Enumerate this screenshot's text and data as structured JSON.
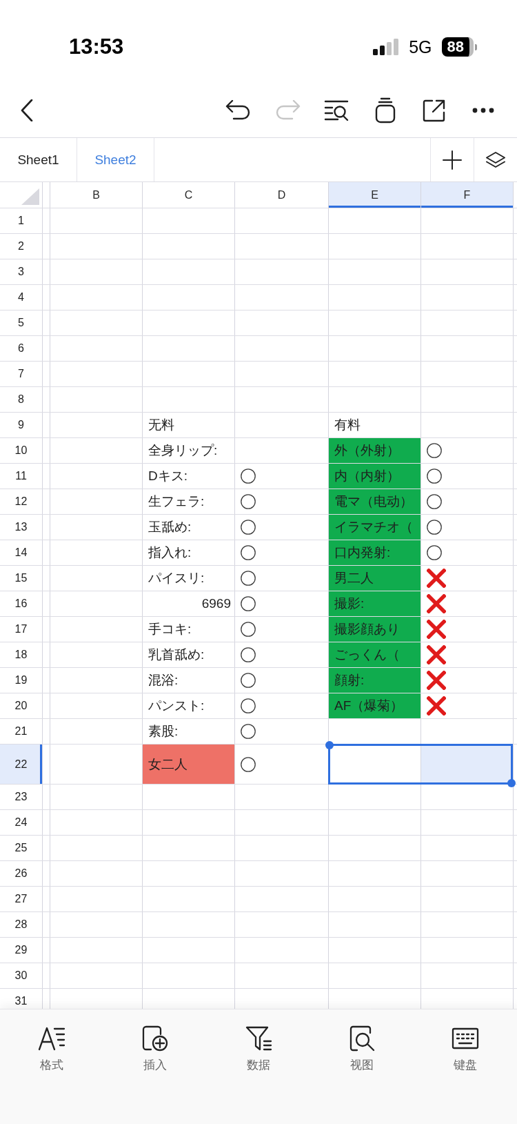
{
  "status_bar": {
    "time": "13:53",
    "network": "5G",
    "battery": "88"
  },
  "toolbar": [
    {
      "kind": "back",
      "disabled": false
    },
    {
      "kind": "undo",
      "disabled": false
    },
    {
      "kind": "redo",
      "disabled": true
    },
    {
      "kind": "find",
      "disabled": false
    },
    {
      "kind": "stack",
      "disabled": false
    },
    {
      "kind": "share",
      "disabled": false
    },
    {
      "kind": "more",
      "disabled": false
    }
  ],
  "sheet_tabs": [
    {
      "label": "Sheet1",
      "selected": false
    },
    {
      "label": "Sheet2",
      "selected": true
    }
  ],
  "sheet_actions": [
    {
      "kind": "add"
    },
    {
      "kind": "layers"
    }
  ],
  "columns": [
    {
      "label": "B",
      "selected": false
    },
    {
      "label": "C",
      "selected": false
    },
    {
      "label": "D",
      "selected": false
    },
    {
      "label": "E",
      "selected": true
    },
    {
      "label": "F",
      "selected": true
    }
  ],
  "rows": [
    {
      "number": "1",
      "selected": false
    },
    {
      "number": "2",
      "selected": false
    },
    {
      "number": "3",
      "selected": false
    },
    {
      "number": "4",
      "selected": false
    },
    {
      "number": "5",
      "selected": false
    },
    {
      "number": "6",
      "selected": false
    },
    {
      "number": "7",
      "selected": false
    },
    {
      "number": "8",
      "selected": false
    },
    {
      "number": "9",
      "selected": false,
      "c": {
        "kind": "text",
        "text": "无料"
      },
      "e": {
        "kind": "text",
        "text": "有料"
      }
    },
    {
      "number": "10",
      "selected": false,
      "c": {
        "kind": "text",
        "text": "全身リップ:"
      },
      "e": {
        "kind": "text",
        "text": "外（外射）",
        "color": "#10ac4e"
      },
      "f": {
        "kind": "circle"
      }
    },
    {
      "number": "11",
      "selected": false,
      "c": {
        "kind": "text",
        "text": "Dキス:"
      },
      "d": {
        "kind": "circle"
      },
      "e": {
        "kind": "text",
        "text": "内（内射）",
        "color": "#10ac4e"
      },
      "f": {
        "kind": "circle"
      }
    },
    {
      "number": "12",
      "selected": false,
      "c": {
        "kind": "text",
        "text": "生フェラ:"
      },
      "d": {
        "kind": "circle"
      },
      "e": {
        "kind": "text",
        "text": "電マ（电动）",
        "color": "#10ac4e"
      },
      "f": {
        "kind": "circle"
      }
    },
    {
      "number": "13",
      "selected": false,
      "c": {
        "kind": "text",
        "text": "玉舐め:"
      },
      "d": {
        "kind": "circle"
      },
      "e": {
        "kind": "text",
        "text": "イラマチオ（",
        "color": "#10ac4e"
      },
      "f": {
        "kind": "circle"
      }
    },
    {
      "number": "14",
      "selected": false,
      "c": {
        "kind": "text",
        "text": "指入れ:"
      },
      "d": {
        "kind": "circle"
      },
      "e": {
        "kind": "text",
        "text": "口内発射:",
        "color": "#10ac4e"
      },
      "f": {
        "kind": "circle"
      }
    },
    {
      "number": "15",
      "selected": false,
      "c": {
        "kind": "text",
        "text": "パイスリ:"
      },
      "d": {
        "kind": "circle"
      },
      "e": {
        "kind": "text",
        "text": "男二人",
        "color": "#10ac4e"
      },
      "f": {
        "kind": "cross"
      }
    },
    {
      "number": "16",
      "selected": false,
      "c": {
        "kind": "number",
        "text": "6969"
      },
      "d": {
        "kind": "circle"
      },
      "e": {
        "kind": "text",
        "text": "撮影:",
        "color": "#10ac4e"
      },
      "f": {
        "kind": "cross"
      }
    },
    {
      "number": "17",
      "selected": false,
      "c": {
        "kind": "text",
        "text": "手コキ:"
      },
      "d": {
        "kind": "circle"
      },
      "e": {
        "kind": "text",
        "text": "撮影顔あり",
        "color": "#10ac4e"
      },
      "f": {
        "kind": "cross"
      }
    },
    {
      "number": "18",
      "selected": false,
      "c": {
        "kind": "text",
        "text": "乳首舐め:"
      },
      "d": {
        "kind": "circle"
      },
      "e": {
        "kind": "text",
        "text": "ごっくん（",
        "color": "#10ac4e"
      },
      "f": {
        "kind": "cross"
      }
    },
    {
      "number": "19",
      "selected": false,
      "c": {
        "kind": "text",
        "text": "混浴:"
      },
      "d": {
        "kind": "circle"
      },
      "e": {
        "kind": "text",
        "text": "顔射:",
        "color": "#10ac4e"
      },
      "f": {
        "kind": "cross"
      }
    },
    {
      "number": "20",
      "selected": false,
      "c": {
        "kind": "text",
        "text": "パンスト:"
      },
      "d": {
        "kind": "circle"
      },
      "e": {
        "kind": "text",
        "text": "AF（爆菊）",
        "color": "#10ac4e"
      },
      "f": {
        "kind": "cross"
      }
    },
    {
      "number": "21",
      "selected": false,
      "c": {
        "kind": "text",
        "text": "素股:"
      },
      "d": {
        "kind": "circle"
      }
    },
    {
      "number": "22",
      "selected": true,
      "c": {
        "kind": "text",
        "text": "女二人",
        "color": "#ee7167"
      },
      "d": {
        "kind": "circle"
      }
    },
    {
      "number": "23",
      "selected": false
    },
    {
      "number": "24",
      "selected": false
    },
    {
      "number": "25",
      "selected": false
    },
    {
      "number": "26",
      "selected": false
    },
    {
      "number": "27",
      "selected": false
    },
    {
      "number": "28",
      "selected": false
    },
    {
      "number": "29",
      "selected": false
    },
    {
      "number": "30",
      "selected": false
    },
    {
      "number": "31",
      "selected": false
    }
  ],
  "bottom_toolbar": [
    {
      "kind": "format",
      "label": "格式"
    },
    {
      "kind": "insert",
      "label": "插入"
    },
    {
      "kind": "data",
      "label": "数据"
    },
    {
      "kind": "view",
      "label": "视图"
    },
    {
      "kind": "keyboard",
      "label": "键盘"
    }
  ]
}
